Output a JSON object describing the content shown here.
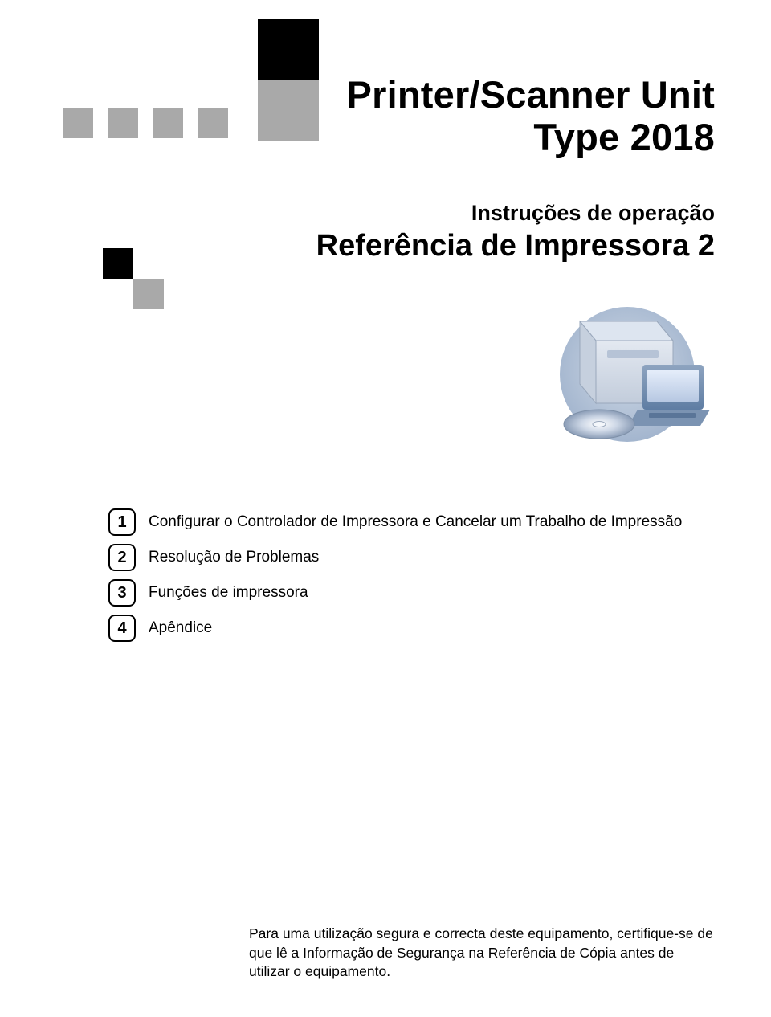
{
  "title": {
    "line1": "Printer/Scanner Unit",
    "line2": "Type 2018"
  },
  "subtitle": {
    "small": "Instruções de operação",
    "large": "Referência de Impressora 2"
  },
  "toc": [
    {
      "num": "1",
      "label": "Configurar o Controlador de Impressora e Cancelar um Trabalho de Impressão"
    },
    {
      "num": "2",
      "label": "Resolução de Problemas"
    },
    {
      "num": "3",
      "label": "Funções de impressora"
    },
    {
      "num": "4",
      "label": "Apêndice"
    }
  ],
  "footer": "Para uma utilização segura e correcta deste equipamento, certifique-se de que lê a Informação de Segurança na Referência de Cópia antes de utilizar o equipamento."
}
